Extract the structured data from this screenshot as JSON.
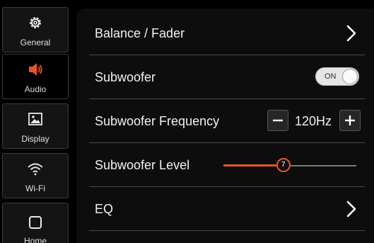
{
  "sidebar": {
    "items": [
      {
        "label": "General",
        "icon": "gear-icon"
      },
      {
        "label": "Audio",
        "icon": "speaker-icon",
        "active": true
      },
      {
        "label": "Display",
        "icon": "image-icon"
      },
      {
        "label": "Wi-Fi",
        "icon": "wifi-icon"
      },
      {
        "label": "Home",
        "icon": "home-square-icon"
      }
    ]
  },
  "settings": {
    "balance_fader": {
      "label": "Balance / Fader"
    },
    "subwoofer": {
      "label": "Subwoofer",
      "toggle_text": "ON",
      "enabled": true
    },
    "subwoofer_frequency": {
      "label": "Subwoofer Frequency",
      "value": "120Hz",
      "minus": "−",
      "plus": "+"
    },
    "subwoofer_level": {
      "label": "Subwoofer Level",
      "value": 7,
      "fraction": 0.45
    },
    "eq": {
      "label": "EQ"
    }
  },
  "colors": {
    "accent": "#e8551f",
    "audio_icon": "#e8551f",
    "background": "#000000",
    "panel": "#0d0d0d"
  }
}
